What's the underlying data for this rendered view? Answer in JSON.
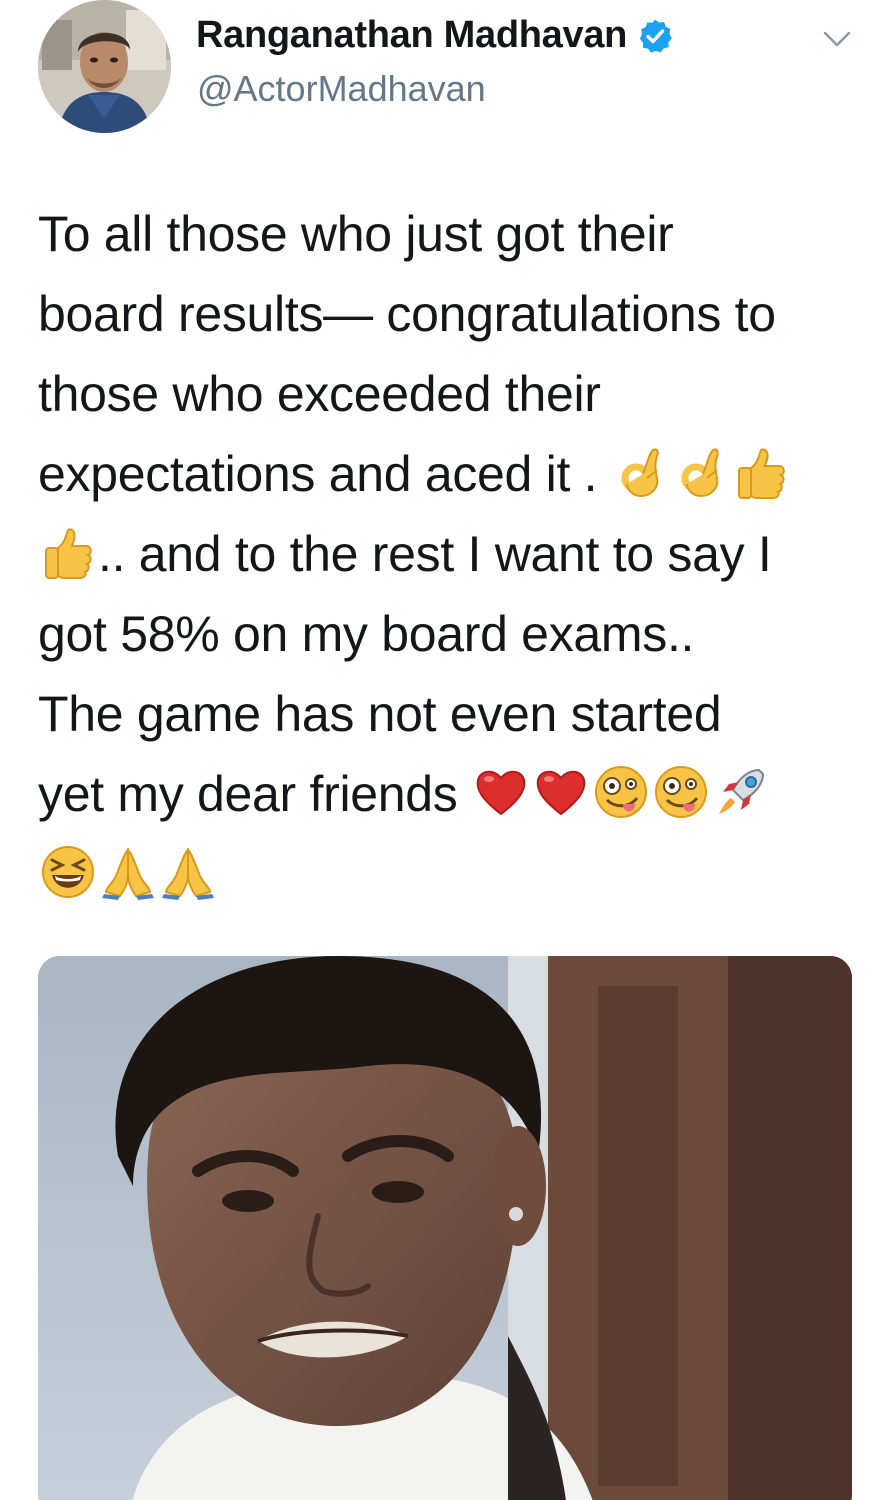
{
  "tweet": {
    "author": {
      "display_name": "Ranganathan Madhavan",
      "handle": "@ActorMadhavan",
      "verified": true
    },
    "lines": [
      [
        {
          "t": "text",
          "v": "To all those who just got their"
        }
      ],
      [
        {
          "t": "text",
          "v": "board results— congratulations to"
        }
      ],
      [
        {
          "t": "text",
          "v": "those who exceeded their"
        }
      ],
      [
        {
          "t": "text",
          "v": "expectations and aced it . "
        },
        {
          "t": "emoji",
          "v": "ok-hand"
        },
        {
          "t": "emoji",
          "v": "ok-hand"
        },
        {
          "t": "emoji",
          "v": "thumbs-up"
        }
      ],
      [
        {
          "t": "emoji",
          "v": "thumbs-up"
        },
        {
          "t": "text",
          "v": ".. and to the rest I want to say I"
        }
      ],
      [
        {
          "t": "text",
          "v": "got 58% on my board exams.."
        }
      ],
      [
        {
          "t": "text",
          "v": "The game has not even started"
        }
      ],
      [
        {
          "t": "text",
          "v": "yet my dear friends "
        },
        {
          "t": "emoji",
          "v": "red-heart"
        },
        {
          "t": "emoji",
          "v": "red-heart"
        },
        {
          "t": "emoji",
          "v": "zany-face"
        },
        {
          "t": "emoji",
          "v": "zany-face"
        },
        {
          "t": "emoji",
          "v": "rocket"
        }
      ],
      [
        {
          "t": "emoji",
          "v": "grinning-squinting-face"
        },
        {
          "t": "emoji",
          "v": "folded-hands"
        },
        {
          "t": "emoji",
          "v": "folded-hands"
        }
      ]
    ],
    "media": {
      "type": "photo"
    }
  },
  "colors": {
    "text_primary": "#14171a",
    "text_secondary": "#657786",
    "verified_blue": "#1da1f2",
    "chevron": "#8899a6"
  }
}
